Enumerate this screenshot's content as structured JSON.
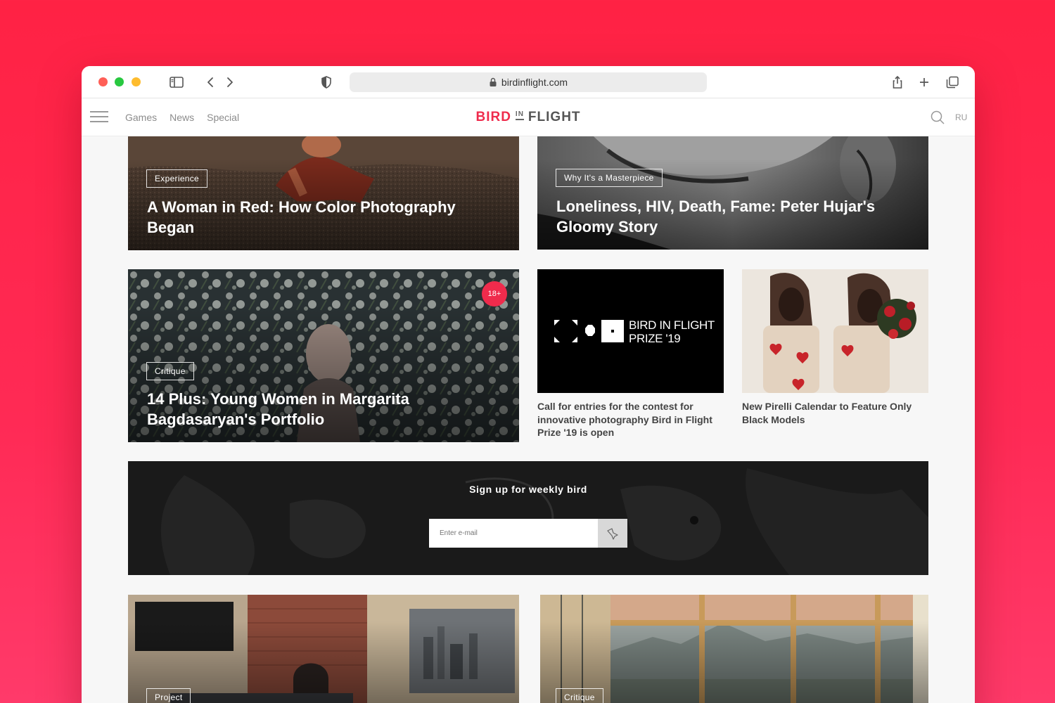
{
  "browser": {
    "url": "birdinflight.com"
  },
  "site": {
    "nav": [
      "Games",
      "News",
      "Special"
    ],
    "logo": {
      "part1": "BIRD",
      "part2": "IN",
      "part3": "FLIGHT"
    },
    "lang": "RU"
  },
  "articles": {
    "a1": {
      "tag": "Experience",
      "title": "A Woman in Red: How Color Photography Began"
    },
    "a2": {
      "tag": "Why It's a Masterpiece",
      "title": "Loneliness, HIV, Death, Fame: Peter Hujar's Gloomy Story"
    },
    "a3": {
      "tag": "Critique",
      "title": "14 Plus: Young Women in Margarita Bagdasaryan's Portfolio",
      "badge": "18+"
    },
    "a4": {
      "caption": "Call for entries for the contest for innovative photography Bird in Flight Prize '19 is open",
      "logo_line1": "BIRD IN FLIGHT",
      "logo_line2": "PRIZE '19"
    },
    "a5": {
      "caption": "New Pirelli Calendar to Feature Only Black Models"
    },
    "a6": {
      "tag": "Project"
    },
    "a7": {
      "tag": "Critique"
    }
  },
  "newsletter": {
    "title": "Sign up for weekly bird",
    "placeholder": "Enter e-mail"
  },
  "colors": {
    "accent": "#ef2b4c",
    "background": "#ff2244"
  }
}
